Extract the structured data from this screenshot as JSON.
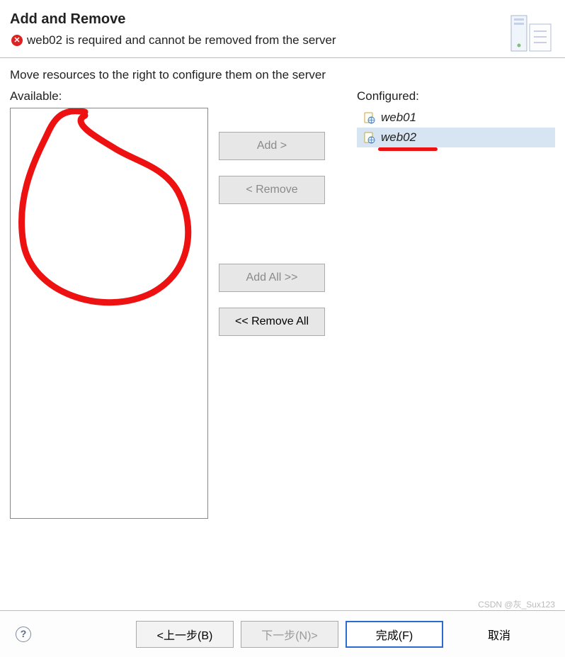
{
  "header": {
    "title": "Add and Remove",
    "error_message": "web02 is required and cannot be removed from the server",
    "icon": "server-config-icon"
  },
  "body": {
    "instructions": "Move resources to the right to configure them on the server",
    "available_label": "Available:",
    "configured_label": "Configured:",
    "available_items": [],
    "configured_items": [
      {
        "label": "web01",
        "selected": false
      },
      {
        "label": "web02",
        "selected": true
      }
    ]
  },
  "buttons": {
    "add": "Add >",
    "remove": "< Remove",
    "add_all": "Add All >>",
    "remove_all": "<< Remove All"
  },
  "footer": {
    "back": "<上一步(B)",
    "next": "下一步(N)>",
    "finish": "完成(F)",
    "cancel": "取消"
  },
  "footer_state": {
    "back_enabled": true,
    "next_enabled": false,
    "finish_enabled": true,
    "cancel_enabled": true
  },
  "transfer_state": {
    "add_enabled": false,
    "remove_enabled": false,
    "add_all_enabled": false,
    "remove_all_enabled": true
  },
  "annotations": {
    "red_circle_in_available": true,
    "red_underline_on": "web02"
  },
  "watermark": "CSDN @灰_Sux123"
}
